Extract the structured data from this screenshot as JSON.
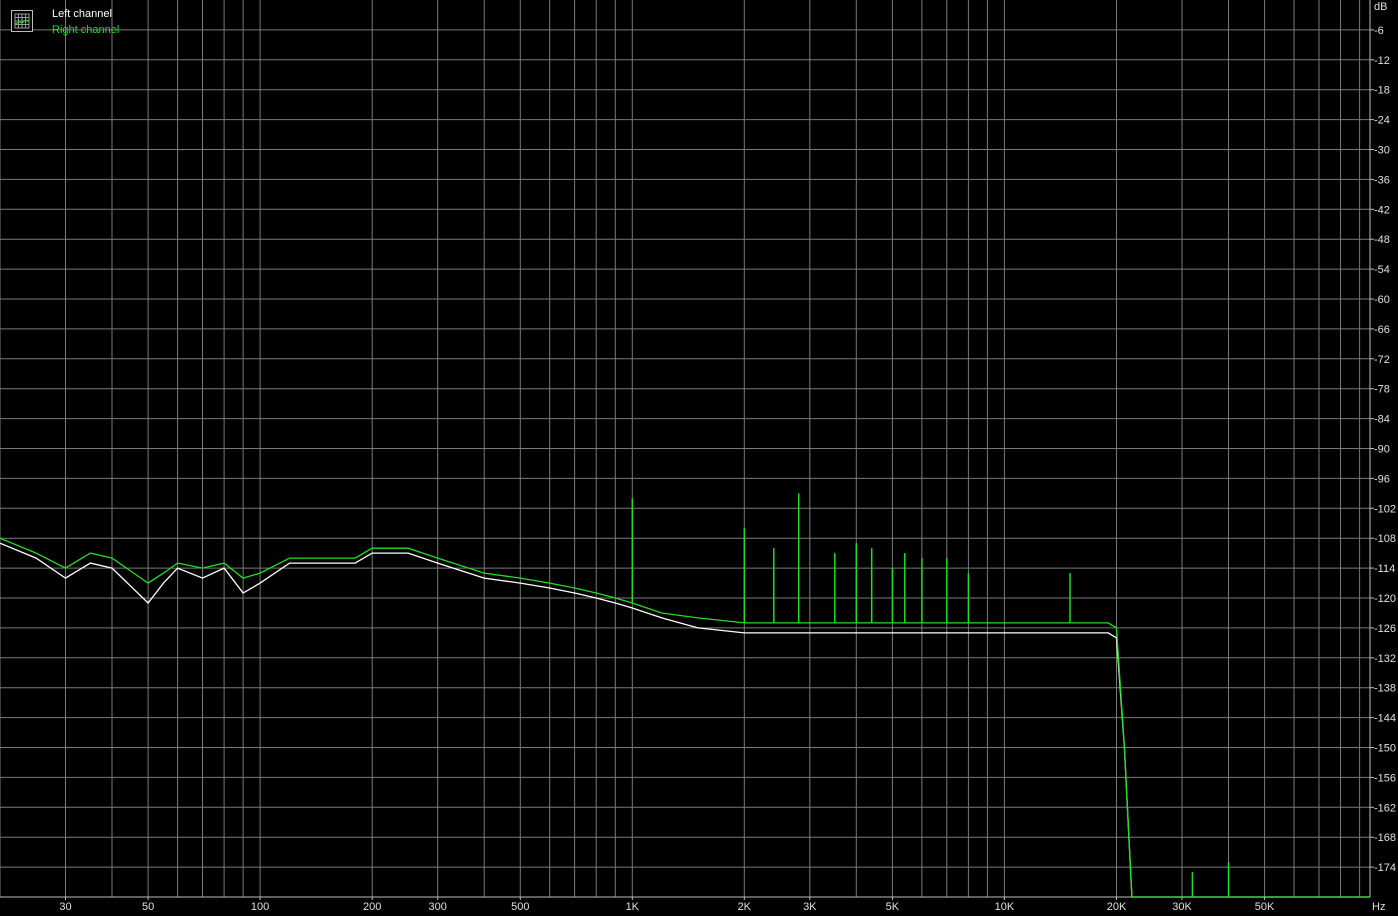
{
  "chart_data": {
    "type": "line",
    "x_scale": "log",
    "xlim": [
      20,
      96000
    ],
    "ylim": [
      -180,
      0
    ],
    "grid": true,
    "legend_placement": "top-left",
    "ylabel": "dB",
    "xlabel": "Hz",
    "y_ticks": [
      -6,
      -12,
      -18,
      -24,
      -30,
      -36,
      -42,
      -48,
      -54,
      -60,
      -66,
      -72,
      -78,
      -84,
      -90,
      -96,
      -102,
      -108,
      -114,
      -120,
      -126,
      -132,
      -138,
      -144,
      -150,
      -156,
      -162,
      -168,
      -174
    ],
    "x_ticks": [
      {
        "value": 30,
        "label": "30"
      },
      {
        "value": 50,
        "label": "50"
      },
      {
        "value": 100,
        "label": "100"
      },
      {
        "value": 200,
        "label": "200"
      },
      {
        "value": 300,
        "label": "300"
      },
      {
        "value": 500,
        "label": "500"
      },
      {
        "value": 1000,
        "label": "1K"
      },
      {
        "value": 2000,
        "label": "2K"
      },
      {
        "value": 3000,
        "label": "3K"
      },
      {
        "value": 5000,
        "label": "5K"
      },
      {
        "value": 10000,
        "label": "10K"
      },
      {
        "value": 20000,
        "label": "20K"
      },
      {
        "value": 30000,
        "label": "30K"
      },
      {
        "value": 50000,
        "label": "50K"
      }
    ],
    "x_grid_values": [
      20,
      30,
      40,
      50,
      60,
      70,
      80,
      90,
      100,
      200,
      300,
      400,
      500,
      600,
      700,
      800,
      900,
      1000,
      2000,
      3000,
      4000,
      5000,
      6000,
      7000,
      8000,
      9000,
      10000,
      20000,
      30000,
      40000,
      50000,
      60000,
      70000,
      80000,
      90000
    ],
    "series": [
      {
        "name": "Left channel",
        "color": "#ffffff",
        "points": [
          [
            20,
            -109
          ],
          [
            25,
            -112
          ],
          [
            30,
            -116
          ],
          [
            35,
            -113
          ],
          [
            40,
            -114
          ],
          [
            50,
            -121
          ],
          [
            55,
            -117
          ],
          [
            60,
            -114
          ],
          [
            70,
            -116
          ],
          [
            80,
            -114
          ],
          [
            90,
            -119
          ],
          [
            100,
            -117
          ],
          [
            120,
            -113
          ],
          [
            150,
            -113
          ],
          [
            180,
            -113
          ],
          [
            200,
            -111
          ],
          [
            250,
            -111
          ],
          [
            300,
            -113
          ],
          [
            400,
            -116
          ],
          [
            500,
            -117
          ],
          [
            600,
            -118
          ],
          [
            700,
            -119
          ],
          [
            800,
            -120
          ],
          [
            900,
            -121
          ],
          [
            1000,
            -122
          ],
          [
            1200,
            -124
          ],
          [
            1500,
            -126
          ],
          [
            2000,
            -127
          ],
          [
            3000,
            -127
          ],
          [
            5000,
            -127
          ],
          [
            7000,
            -127
          ],
          [
            10000,
            -127
          ],
          [
            15000,
            -127
          ],
          [
            19000,
            -127
          ],
          [
            20000,
            -128
          ],
          [
            21000,
            -150
          ],
          [
            22000,
            -180
          ],
          [
            60000,
            -180
          ],
          [
            96000,
            -180
          ]
        ]
      },
      {
        "name": "Right channel",
        "color": "#22dd22",
        "points": [
          [
            20,
            -108
          ],
          [
            25,
            -111
          ],
          [
            30,
            -114
          ],
          [
            35,
            -111
          ],
          [
            40,
            -112
          ],
          [
            50,
            -117
          ],
          [
            55,
            -115
          ],
          [
            60,
            -113
          ],
          [
            70,
            -114
          ],
          [
            80,
            -113
          ],
          [
            90,
            -116
          ],
          [
            100,
            -115
          ],
          [
            120,
            -112
          ],
          [
            150,
            -112
          ],
          [
            180,
            -112
          ],
          [
            200,
            -110
          ],
          [
            250,
            -110
          ],
          [
            300,
            -112
          ],
          [
            400,
            -115
          ],
          [
            500,
            -116
          ],
          [
            600,
            -117
          ],
          [
            700,
            -118
          ],
          [
            800,
            -119
          ],
          [
            900,
            -120
          ],
          [
            1000,
            -121
          ],
          [
            1200,
            -123
          ],
          [
            1500,
            -124
          ],
          [
            2000,
            -125
          ],
          [
            3000,
            -125
          ],
          [
            5000,
            -125
          ],
          [
            7000,
            -125
          ],
          [
            10000,
            -125
          ],
          [
            15000,
            -125
          ],
          [
            19000,
            -125
          ],
          [
            20000,
            -126
          ],
          [
            21000,
            -150
          ],
          [
            22000,
            -180
          ],
          [
            60000,
            -180
          ],
          [
            96000,
            -180
          ]
        ],
        "spikes": [
          [
            1000,
            -100
          ],
          [
            2000,
            -106
          ],
          [
            2400,
            -110
          ],
          [
            2800,
            -99
          ],
          [
            3500,
            -111
          ],
          [
            4000,
            -109
          ],
          [
            4400,
            -110
          ],
          [
            5000,
            -114
          ],
          [
            5400,
            -111
          ],
          [
            6000,
            -112
          ],
          [
            7000,
            -112
          ],
          [
            8000,
            -115
          ],
          [
            15000,
            -115
          ],
          [
            32000,
            -175
          ],
          [
            40000,
            -173
          ]
        ]
      }
    ]
  }
}
